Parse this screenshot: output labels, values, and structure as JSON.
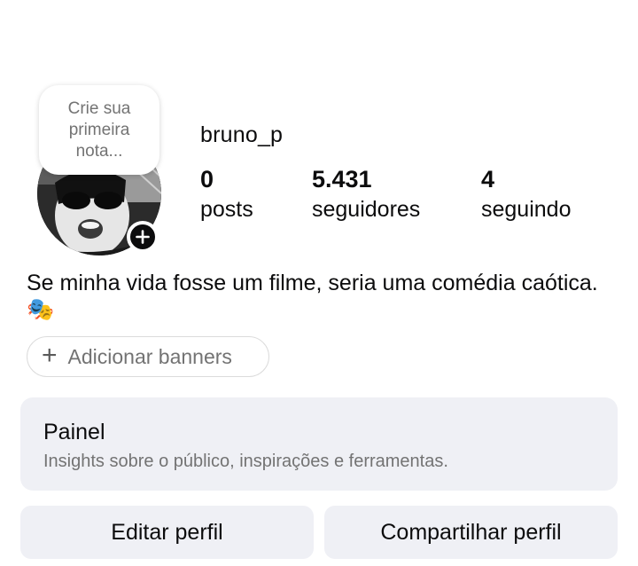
{
  "profile": {
    "username": "bruno_p",
    "note_prompt": "Crie sua primeira nota...",
    "stats": {
      "posts": {
        "count": "0",
        "label": "posts"
      },
      "followers": {
        "count": "5.431",
        "label": "seguidores"
      },
      "following": {
        "count": "4",
        "label": "seguindo"
      }
    },
    "bio": "Se minha vida fosse um filme, seria uma comédia caótica. 🎭"
  },
  "banners": {
    "add_label": "Adicionar banners"
  },
  "panel": {
    "title": "Painel",
    "subtitle": "Insights sobre o público, inspirações e ferramentas."
  },
  "actions": {
    "edit_label": "Editar perfil",
    "share_label": "Compartilhar perfil"
  },
  "icons": {
    "avatar_add": "plus-icon",
    "banner_add": "plus-icon"
  },
  "colors": {
    "card_bg": "#eff0f5",
    "muted_text": "#737373",
    "text": "#0c0c0d"
  }
}
